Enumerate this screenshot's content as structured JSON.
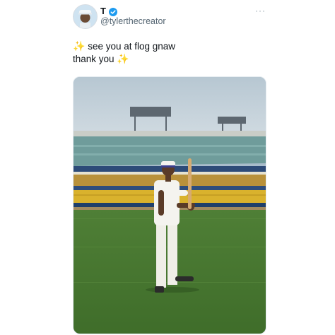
{
  "tweet": {
    "author": {
      "display_name": "T",
      "handle": "@tylerthecreator",
      "verified": true,
      "verified_icon": "verified-badge-icon",
      "avatar_icon": "avatar"
    },
    "more_label": "···",
    "text_lines": [
      {
        "emoji": "✨",
        "text": " see you at flog gnaw"
      },
      {
        "text": "thank you ",
        "emoji": "✨"
      }
    ],
    "media": {
      "type": "photo",
      "subject": "man in white outfit holding baseball bat on stadium field"
    }
  },
  "colors": {
    "text": "#0f1419",
    "secondary": "#536471",
    "verified_blue": "#1d9bf0",
    "sparkle": "#f5c518"
  }
}
